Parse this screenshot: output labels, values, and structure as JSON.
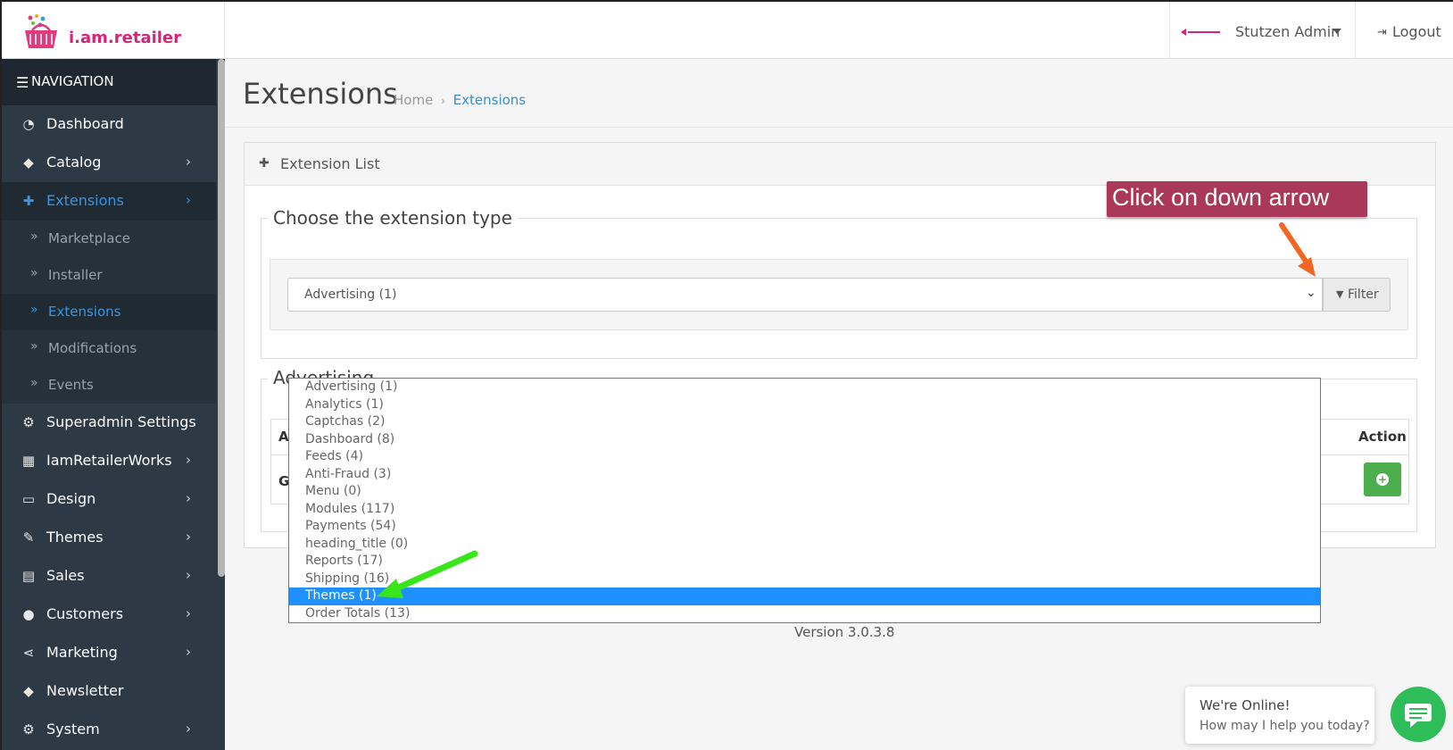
{
  "header": {
    "logo_text": "i.am.retailer",
    "user_name": "Stutzen Admin",
    "logout_label": "Logout"
  },
  "sidebar": {
    "title": "NAVIGATION",
    "items": [
      {
        "label": "Dashboard",
        "icon": "dashboard-icon"
      },
      {
        "label": "Catalog",
        "icon": "tags-icon"
      },
      {
        "label": "Extensions",
        "icon": "puzzle-icon"
      },
      {
        "label": "Superadmin Settings",
        "icon": "cogs-icon"
      },
      {
        "label": "IamRetailerWorks",
        "icon": "cubes-icon"
      },
      {
        "label": "Design",
        "icon": "monitor-icon"
      },
      {
        "label": "Themes",
        "icon": "paintbrush-icon"
      },
      {
        "label": "Sales",
        "icon": "cart-icon"
      },
      {
        "label": "Customers",
        "icon": "user-icon"
      },
      {
        "label": "Marketing",
        "icon": "share-icon"
      },
      {
        "label": "Newsletter",
        "icon": "tags-icon"
      },
      {
        "label": "System",
        "icon": "gear-icon"
      }
    ],
    "extensions_sub": [
      {
        "label": "Marketplace"
      },
      {
        "label": "Installer"
      },
      {
        "label": "Extensions"
      },
      {
        "label": "Modifications"
      },
      {
        "label": "Events"
      }
    ]
  },
  "page": {
    "title": "Extensions",
    "breadcrumb": [
      {
        "label": "Home"
      },
      {
        "label": "Extensions"
      }
    ]
  },
  "panel": {
    "heading": "Extension List",
    "choose_legend": "Choose the extension type",
    "selected_type": "Advertising (1)",
    "filter_label": "Filter",
    "list_legend": "Advertising",
    "table": {
      "first_header": "A",
      "action_header": "Action",
      "first_cell": "G"
    }
  },
  "dropdown": {
    "options": [
      "Advertising (1)",
      "Analytics (1)",
      "Captchas (2)",
      "Dashboard (8)",
      "Feeds (4)",
      "Anti-Fraud (3)",
      "Menu (0)",
      "Modules (117)",
      "Payments (54)",
      "heading_title (0)",
      "Reports (17)",
      "Shipping (16)",
      "Themes (1)",
      "Order Totals (13)"
    ],
    "highlighted": "Themes (1)"
  },
  "version": "Version 3.0.3.8",
  "annotation": {
    "callout_text": "Click on down arrow",
    "callout_color": "#a9385a",
    "orange_arrow_color": "#f26522",
    "green_arrow_color": "#39e61c"
  },
  "chat": {
    "title": "We're Online!",
    "subtitle": "How may I help you today?"
  },
  "colors": {
    "sidebar_bg": "#2d3945",
    "accent": "#3c95e0",
    "success": "#4cae4c",
    "highlight": "#1e90ff",
    "chat": "#2ebd59"
  }
}
